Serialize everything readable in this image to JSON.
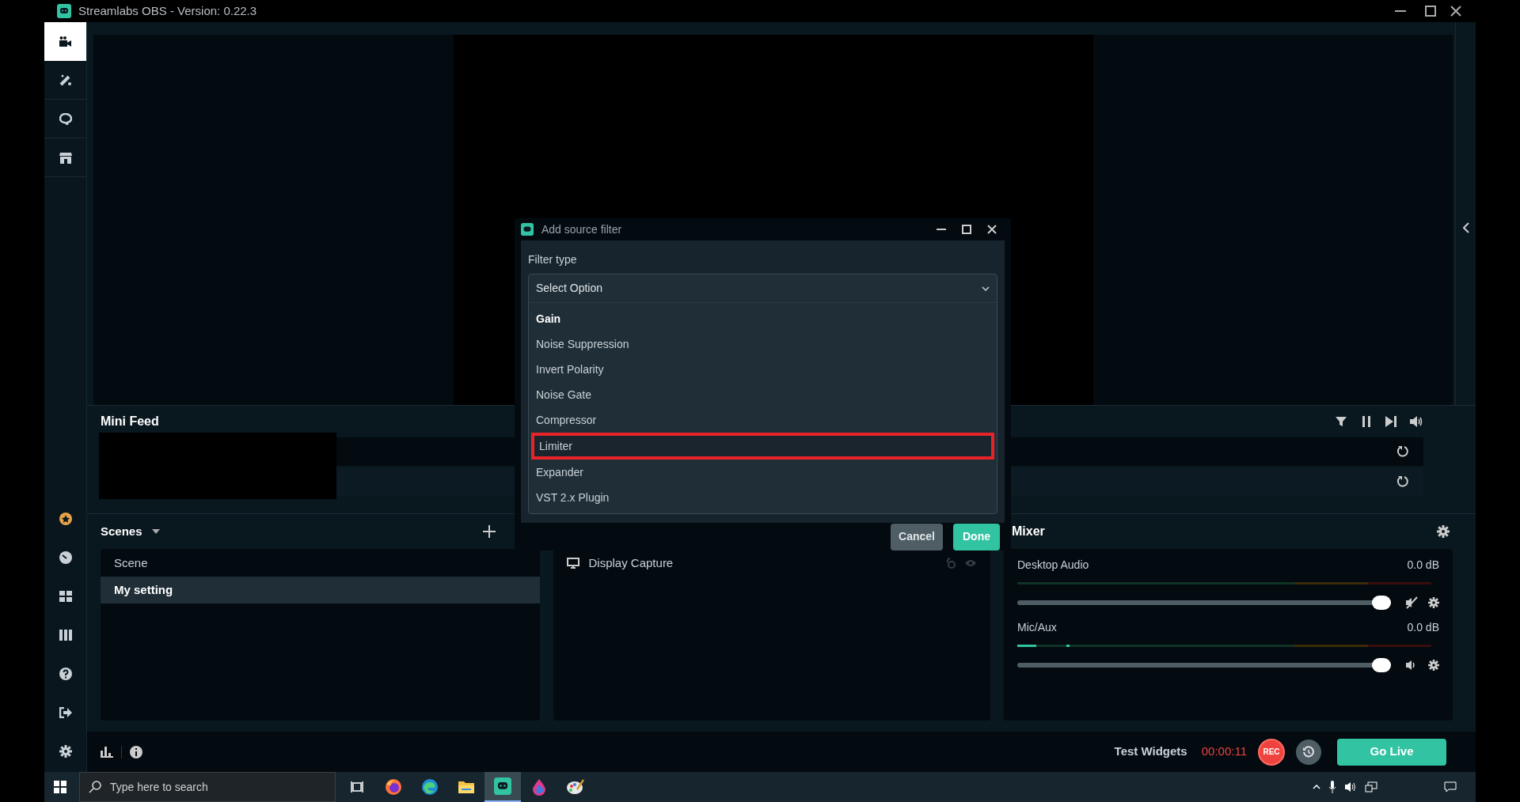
{
  "window": {
    "title": "Streamlabs OBS - Version: 0.22.3"
  },
  "nav_top": [
    {
      "kind": "camera",
      "selected": true
    },
    {
      "kind": "wand",
      "selected": false
    },
    {
      "kind": "chat",
      "selected": false
    },
    {
      "kind": "store",
      "selected": false
    }
  ],
  "nav_bottom": [
    {
      "kind": "star"
    },
    {
      "kind": "gauge"
    },
    {
      "kind": "grid"
    },
    {
      "kind": "columns"
    },
    {
      "kind": "help"
    },
    {
      "kind": "logout"
    },
    {
      "kind": "settings"
    }
  ],
  "mini_feed": {
    "title": "Mini Feed"
  },
  "scenes": {
    "title": "Scenes",
    "items": [
      {
        "label": "Scene",
        "selected": false
      },
      {
        "label": "My setting",
        "selected": true
      }
    ]
  },
  "sources": {
    "items": [
      {
        "label": "Display Capture"
      }
    ]
  },
  "mixer": {
    "title": "Mixer",
    "channels": [
      {
        "name": "Desktop Audio",
        "reading": "0.0 dB",
        "muted": true,
        "level": 1
      },
      {
        "name": "Mic/Aux",
        "reading": "0.0 dB",
        "muted": false,
        "level": 1
      }
    ]
  },
  "footer": {
    "test_widgets": "Test Widgets",
    "timer": "00:00:11",
    "rec": "REC",
    "go_live": "Go Live"
  },
  "dialog": {
    "title": "Add source filter",
    "label": "Filter type",
    "select": "Select Option",
    "options": [
      {
        "label": "Gain",
        "current": true,
        "selected": false
      },
      {
        "label": "Noise Suppression",
        "current": false,
        "selected": false
      },
      {
        "label": "Invert Polarity",
        "current": false,
        "selected": false
      },
      {
        "label": "Noise Gate",
        "current": false,
        "selected": false
      },
      {
        "label": "Compressor",
        "current": false,
        "selected": false
      },
      {
        "label": "Limiter",
        "current": false,
        "selected": true
      },
      {
        "label": "Expander",
        "current": false,
        "selected": false
      },
      {
        "label": "VST 2.x Plugin",
        "current": false,
        "selected": false
      }
    ],
    "buttons": [
      {
        "label": "Cancel",
        "kind": "secondary"
      },
      {
        "label": "Done",
        "kind": "primary"
      }
    ]
  },
  "taskbar": {
    "search_placeholder": "Type here to search",
    "apps": [
      {
        "kind": "taskview",
        "selected": false
      },
      {
        "kind": "firefox",
        "selected": false
      },
      {
        "kind": "edge",
        "selected": false
      },
      {
        "kind": "folder",
        "selected": false
      },
      {
        "kind": "streamlabs",
        "selected": true
      },
      {
        "kind": "drop",
        "selected": false
      },
      {
        "kind": "palette",
        "selected": false
      }
    ]
  }
}
